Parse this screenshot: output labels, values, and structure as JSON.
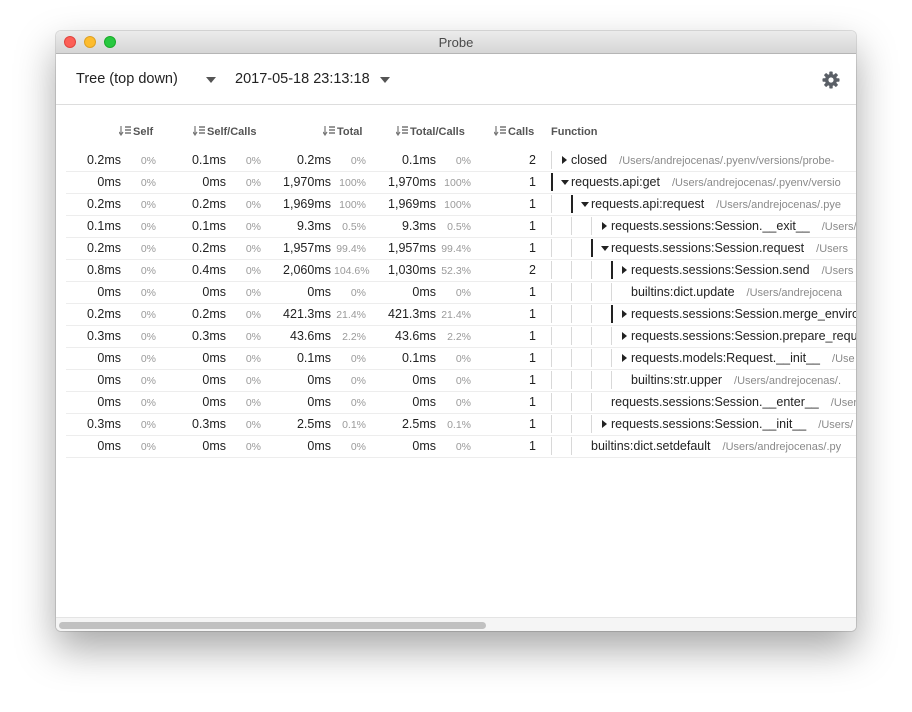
{
  "window": {
    "title": "Probe"
  },
  "toolbar": {
    "view_mode": "Tree (top down)",
    "snapshot": "2017-05-18 23:13:18",
    "settings_icon": "gear-icon"
  },
  "columns": {
    "self": "Self",
    "self_calls": "Self/Calls",
    "total": "Total",
    "total_calls": "Total/Calls",
    "calls": "Calls",
    "function": "Function"
  },
  "rows": [
    {
      "self": "0.2ms",
      "self_pct": "0%",
      "self_calls": "0.1ms",
      "self_calls_pct": "0%",
      "total": "0.2ms",
      "total_pct": "0%",
      "total_calls": "0.1ms",
      "total_calls_pct": "0%",
      "calls": "2",
      "func": "closed",
      "path": "/Users/andrejocenas/.pyenv/versions/probe-",
      "expander": "collapsed"
    },
    {
      "self": "0ms",
      "self_pct": "0%",
      "self_calls": "0ms",
      "self_calls_pct": "0%",
      "total": "1,970ms",
      "total_pct": "100%",
      "total_calls": "1,970ms",
      "total_calls_pct": "100%",
      "calls": "1",
      "func": "requests.api:get",
      "path": "/Users/andrejocenas/.pyenv/versio",
      "expander": "expanded"
    },
    {
      "self": "0.2ms",
      "self_pct": "0%",
      "self_calls": "0.2ms",
      "self_calls_pct": "0%",
      "total": "1,969ms",
      "total_pct": "100%",
      "total_calls": "1,969ms",
      "total_calls_pct": "100%",
      "calls": "1",
      "func": "requests.api:request",
      "path": "/Users/andrejocenas/.pye",
      "expander": "expanded"
    },
    {
      "self": "0.1ms",
      "self_pct": "0%",
      "self_calls": "0.1ms",
      "self_calls_pct": "0%",
      "total": "9.3ms",
      "total_pct": "0.5%",
      "total_calls": "9.3ms",
      "total_calls_pct": "0.5%",
      "calls": "1",
      "func": "requests.sessions:Session.__exit__",
      "path": "/Users/",
      "expander": "collapsed"
    },
    {
      "self": "0.2ms",
      "self_pct": "0%",
      "self_calls": "0.2ms",
      "self_calls_pct": "0%",
      "total": "1,957ms",
      "total_pct": "99.4%",
      "total_calls": "1,957ms",
      "total_calls_pct": "99.4%",
      "calls": "1",
      "func": "requests.sessions:Session.request",
      "path": "/Users",
      "expander": "expanded"
    },
    {
      "self": "0.8ms",
      "self_pct": "0%",
      "self_calls": "0.4ms",
      "self_calls_pct": "0%",
      "total": "2,060ms",
      "total_pct": "104.6%",
      "total_calls": "1,030ms",
      "total_calls_pct": "52.3%",
      "calls": "2",
      "func": "requests.sessions:Session.send",
      "path": "/Users",
      "expander": "collapsed"
    },
    {
      "self": "0ms",
      "self_pct": "0%",
      "self_calls": "0ms",
      "self_calls_pct": "0%",
      "total": "0ms",
      "total_pct": "0%",
      "total_calls": "0ms",
      "total_calls_pct": "0%",
      "calls": "1",
      "func": "builtins:dict.update",
      "path": "/Users/andrejocena",
      "expander": "none"
    },
    {
      "self": "0.2ms",
      "self_pct": "0%",
      "self_calls": "0.2ms",
      "self_calls_pct": "0%",
      "total": "421.3ms",
      "total_pct": "21.4%",
      "total_calls": "421.3ms",
      "total_calls_pct": "21.4%",
      "calls": "1",
      "func": "requests.sessions:Session.merge_enviro",
      "path": "",
      "expander": "collapsed"
    },
    {
      "self": "0.3ms",
      "self_pct": "0%",
      "self_calls": "0.3ms",
      "self_calls_pct": "0%",
      "total": "43.6ms",
      "total_pct": "2.2%",
      "total_calls": "43.6ms",
      "total_calls_pct": "2.2%",
      "calls": "1",
      "func": "requests.sessions:Session.prepare_requ",
      "path": "",
      "expander": "collapsed"
    },
    {
      "self": "0ms",
      "self_pct": "0%",
      "self_calls": "0ms",
      "self_calls_pct": "0%",
      "total": "0.1ms",
      "total_pct": "0%",
      "total_calls": "0.1ms",
      "total_calls_pct": "0%",
      "calls": "1",
      "func": "requests.models:Request.__init__",
      "path": "/Use",
      "expander": "collapsed"
    },
    {
      "self": "0ms",
      "self_pct": "0%",
      "self_calls": "0ms",
      "self_calls_pct": "0%",
      "total": "0ms",
      "total_pct": "0%",
      "total_calls": "0ms",
      "total_calls_pct": "0%",
      "calls": "1",
      "func": "builtins:str.upper",
      "path": "/Users/andrejocenas/.",
      "expander": "none"
    },
    {
      "self": "0ms",
      "self_pct": "0%",
      "self_calls": "0ms",
      "self_calls_pct": "0%",
      "total": "0ms",
      "total_pct": "0%",
      "total_calls": "0ms",
      "total_calls_pct": "0%",
      "calls": "1",
      "func": "requests.sessions:Session.__enter__",
      "path": "/Users",
      "expander": "none"
    },
    {
      "self": "0.3ms",
      "self_pct": "0%",
      "self_calls": "0.3ms",
      "self_calls_pct": "0%",
      "total": "2.5ms",
      "total_pct": "0.1%",
      "total_calls": "2.5ms",
      "total_calls_pct": "0.1%",
      "calls": "1",
      "func": "requests.sessions:Session.__init__",
      "path": "/Users/",
      "expander": "collapsed"
    },
    {
      "self": "0ms",
      "self_pct": "0%",
      "self_calls": "0ms",
      "self_calls_pct": "0%",
      "total": "0ms",
      "total_pct": "0%",
      "total_calls": "0ms",
      "total_calls_pct": "0%",
      "calls": "1",
      "func": "builtins:dict.setdefault",
      "path": "/Users/andrejocenas/.py",
      "expander": "none"
    }
  ]
}
